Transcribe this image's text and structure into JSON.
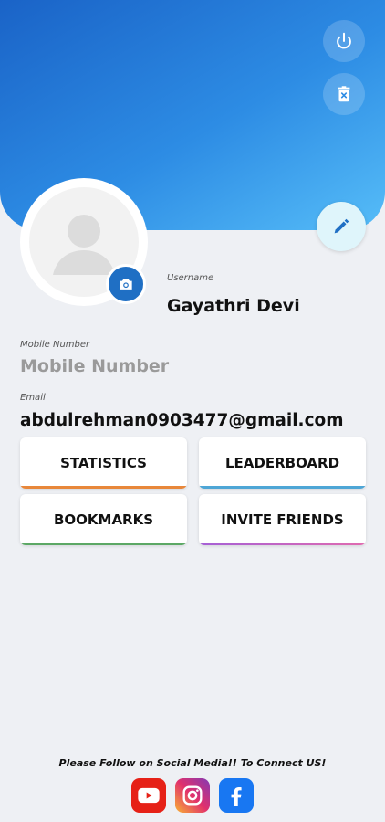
{
  "profile": {
    "username_label": "Username",
    "username": "Gayathri Devi",
    "mobile_label": "Mobile Number",
    "mobile_placeholder": "Mobile Number",
    "email_label": "Email",
    "email": "abdulrehman0903477@gmail.com"
  },
  "actions": [
    {
      "label": "STATISTICS",
      "accent": "#e8873a"
    },
    {
      "label": "LEADERBOARD",
      "accent": "#4ea6d6"
    },
    {
      "label": "BOOKMARKS",
      "accent": "#5ca865"
    },
    {
      "label": "INVITE FRIENDS",
      "accent": "#a560d6"
    }
  ],
  "footer": {
    "text": "Please Follow on Social Media!! To Connect US!"
  },
  "icons": {
    "power": "power-icon",
    "delete": "delete-icon",
    "edit": "pencil-icon",
    "camera": "camera-icon",
    "youtube": "youtube-icon",
    "instagram": "instagram-icon",
    "facebook": "facebook-icon"
  },
  "colors": {
    "header_start": "#1a63c7",
    "header_end": "#56bdf8",
    "camera": "#1f6fc4",
    "youtube": "#e62117",
    "facebook": "#1877f2"
  }
}
